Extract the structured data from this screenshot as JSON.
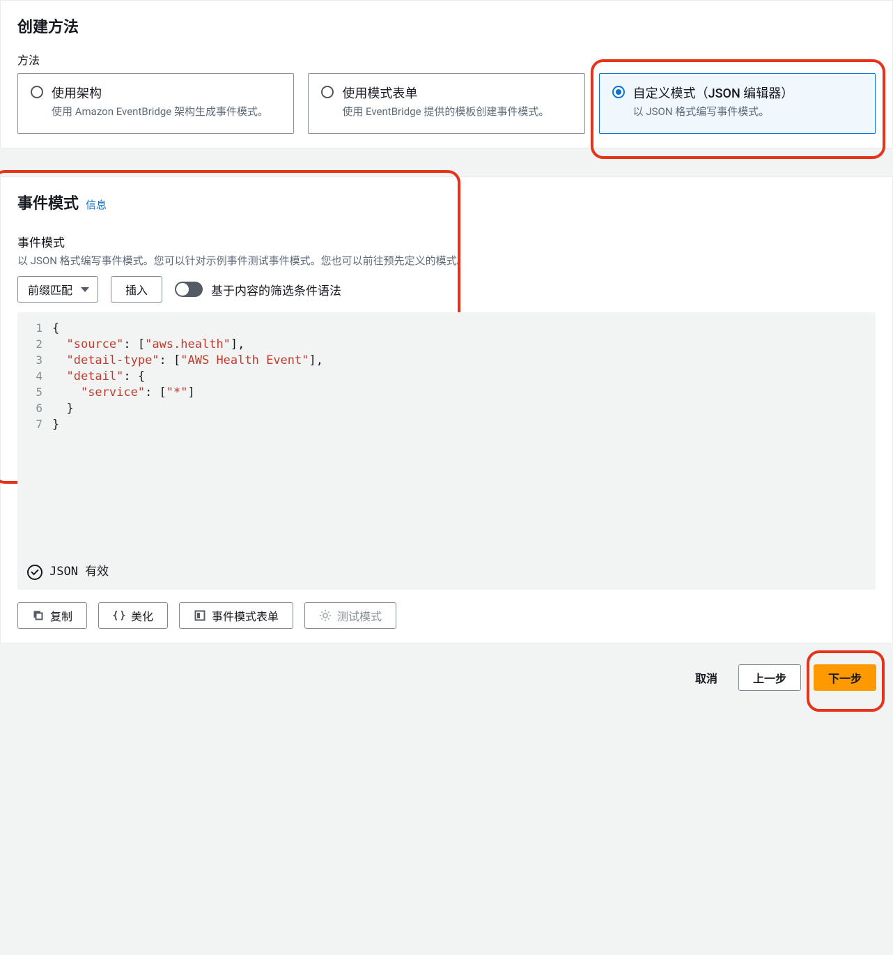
{
  "create_method": {
    "title": "创建方法",
    "field_label": "方法",
    "options": [
      {
        "title": "使用架构",
        "desc": "使用 Amazon EventBridge 架构生成事件模式。",
        "selected": false
      },
      {
        "title": "使用模式表单",
        "desc": "使用 EventBridge 提供的模板创建事件模式。",
        "selected": false
      },
      {
        "title": "自定义模式（JSON 编辑器）",
        "desc": "以 JSON 格式编写事件模式。",
        "selected": true
      }
    ]
  },
  "event_pattern": {
    "title": "事件模式",
    "info_link": "信息",
    "sublabel": "事件模式",
    "help_text": "以 JSON 格式编写事件模式。您可以针对示例事件测试事件模式。您也可以前往预先定义的模式。",
    "prefix_match_label": "前缀匹配",
    "insert_label": "插入",
    "toggle_label": "基于内容的筛选条件语法",
    "toggle_on": false,
    "code_lines": [
      "{",
      "  \"source\": [\"aws.health\"],",
      "  \"detail-type\": [\"AWS Health Event\"],",
      "  \"detail\": {",
      "    \"service\": [\"*\"]",
      "  }",
      "}"
    ],
    "json_valid_label": "JSON 有效",
    "buttons": {
      "copy": "复制",
      "beautify": "美化",
      "form_mode": "事件模式表单",
      "test": "测试模式"
    }
  },
  "footer": {
    "cancel": "取消",
    "previous": "上一步",
    "next": "下一步"
  }
}
